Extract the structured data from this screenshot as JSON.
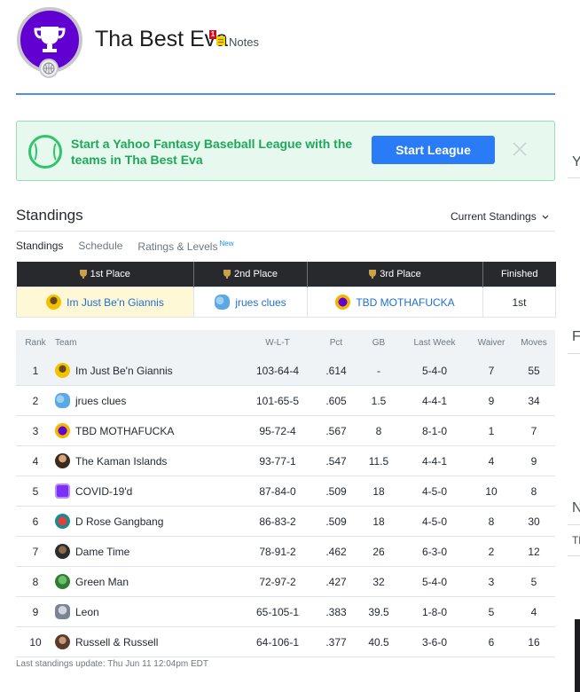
{
  "header": {
    "league_name": "Tha Best Eva",
    "notes_badge": "1",
    "notes_label": "Notes",
    "logo_icon": "trophy-icon",
    "accent_color": "#4d8df6"
  },
  "promo": {
    "text": "Start a Yahoo Fantasy Baseball League with the teams in Tha Best Eva",
    "button_label": "Start League",
    "icon": "baseball-icon",
    "close_icon": "close-icon"
  },
  "standings": {
    "title": "Standings",
    "view_selector": "Current Standings",
    "subtabs": [
      {
        "label": "Standings",
        "active": true
      },
      {
        "label": "Schedule",
        "active": false
      },
      {
        "label": "Ratings & Levels",
        "badge": "New",
        "active": false
      }
    ],
    "places": {
      "headers": [
        "1st Place",
        "2nd Place",
        "3rd Place",
        "Finished"
      ],
      "teams": [
        "Im Just Be'n Giannis",
        "jrues clues",
        "TBD MOTHAFUCKA"
      ],
      "finished": "1st"
    },
    "columns": [
      "Rank",
      "Team",
      "W-L-T",
      "Pct",
      "GB",
      "Last Week",
      "Waiver",
      "Moves"
    ],
    "rows": [
      {
        "rank": "1",
        "team": "Im Just Be'n Giannis",
        "wlt": "103-64-4",
        "pct": ".614",
        "gb": "-",
        "last_week": "5-4-0",
        "waiver": "7",
        "moves": "55"
      },
      {
        "rank": "2",
        "team": "jrues clues",
        "wlt": "101-65-5",
        "pct": ".605",
        "gb": "1.5",
        "last_week": "4-4-1",
        "waiver": "9",
        "moves": "34"
      },
      {
        "rank": "3",
        "team": "TBD MOTHAFUCKA",
        "wlt": "95-72-4",
        "pct": ".567",
        "gb": "8",
        "last_week": "8-1-0",
        "waiver": "1",
        "moves": "7"
      },
      {
        "rank": "4",
        "team": "The Kaman Islands",
        "wlt": "93-77-1",
        "pct": ".547",
        "gb": "11.5",
        "last_week": "4-4-1",
        "waiver": "4",
        "moves": "9"
      },
      {
        "rank": "5",
        "team": "COVID-19'd",
        "wlt": "87-84-0",
        "pct": ".509",
        "gb": "18",
        "last_week": "4-5-0",
        "waiver": "10",
        "moves": "8"
      },
      {
        "rank": "6",
        "team": "D Rose Gangbang",
        "wlt": "86-83-2",
        "pct": ".509",
        "gb": "18",
        "last_week": "4-5-0",
        "waiver": "8",
        "moves": "30"
      },
      {
        "rank": "7",
        "team": "Dame Time",
        "wlt": "78-91-2",
        "pct": ".462",
        "gb": "26",
        "last_week": "6-3-0",
        "waiver": "2",
        "moves": "12"
      },
      {
        "rank": "8",
        "team": "Green Man",
        "wlt": "72-97-2",
        "pct": ".427",
        "gb": "32",
        "last_week": "5-4-0",
        "waiver": "3",
        "moves": "5"
      },
      {
        "rank": "9",
        "team": "Leon",
        "wlt": "65-105-1",
        "pct": ".383",
        "gb": "39.5",
        "last_week": "1-8-0",
        "waiver": "5",
        "moves": "4"
      },
      {
        "rank": "10",
        "team": "Russell & Russell",
        "wlt": "64-106-1",
        "pct": ".377",
        "gb": "40.5",
        "last_week": "3-6-0",
        "waiver": "6",
        "moves": "16"
      }
    ],
    "last_update": "Last standings update: Thu Jun 11 12:04pm EDT"
  },
  "right_column": {
    "clipped_headings": [
      "Y",
      "F",
      "N",
      "Th"
    ]
  }
}
